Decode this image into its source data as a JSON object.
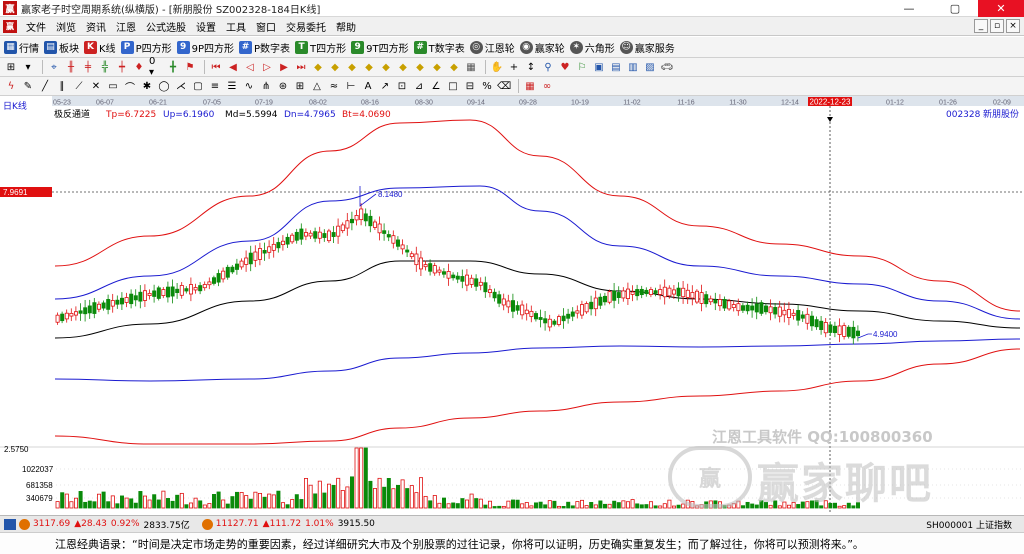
{
  "window": {
    "app_icon": "赢",
    "title": "赢家老子时空周期系统(纵横版) - [新朋股份  SZ002328-184日K线]",
    "buttons": [
      "—",
      "▢",
      "✕"
    ]
  },
  "menu": {
    "icon": "赢",
    "items": [
      "文件",
      "浏览",
      "资讯",
      "江恩",
      "公式选股",
      "设置",
      "工具",
      "窗口",
      "交易委托",
      "帮助"
    ],
    "mdi_buttons": [
      "_",
      "▫",
      "×"
    ]
  },
  "toolbar1": {
    "items": [
      {
        "icon": "grid-icon",
        "label": "行情",
        "color": "#2255aa"
      },
      {
        "icon": "blocks-icon",
        "label": "板块",
        "color": "#2255aa"
      },
      {
        "icon": "kline-icon",
        "label": "K线",
        "color": "#cc2222"
      },
      {
        "icon": "p-icon",
        "label": "P四方形",
        "color": "#3366cc"
      },
      {
        "icon": "9p-icon",
        "label": "9P四方形",
        "color": "#3366cc"
      },
      {
        "icon": "pnum-icon",
        "label": "P数字表",
        "color": "#3366cc"
      },
      {
        "icon": "t-icon",
        "label": "T四方形",
        "color": "#2a8a2a"
      },
      {
        "icon": "9t-icon",
        "label": "9T四方形",
        "color": "#2a8a2a"
      },
      {
        "icon": "tnum-icon",
        "label": "T数字表",
        "color": "#2a8a2a"
      },
      {
        "icon": "gann-wheel-icon",
        "label": "江恩轮",
        "color": "#444444"
      },
      {
        "icon": "winner-wheel-icon",
        "label": "赢家轮",
        "color": "#444444"
      },
      {
        "icon": "hexagon-icon",
        "label": "六角形",
        "color": "#444444"
      },
      {
        "icon": "service-icon",
        "label": "赢家服务",
        "color": "#444444"
      }
    ]
  },
  "chart_info": {
    "period_label": "日K线",
    "indicator_name": "极反通道",
    "tp": "Tp=6.7225",
    "up": "Up=6.1960",
    "md": "Md=5.5994",
    "dn": "Dn=4.7965",
    "bt": "Bt=4.0690",
    "code": "002328",
    "stock_name": "新朋股份",
    "price_marker": "7.9691",
    "high_label": "8.1480",
    "low_label": "4.9400",
    "current_date": "2022-12-23",
    "volume_max": "2.5750",
    "volume_ticks": [
      "1022037",
      "681358",
      "340679"
    ],
    "dates": [
      "05-23",
      "06-07",
      "06-21",
      "07-05",
      "07-19",
      "08-02",
      "08-16",
      "08-30",
      "09-14",
      "09-28",
      "10-19",
      "11-02",
      "11-16",
      "11-30",
      "12-14",
      "2022-12-23",
      "01-12",
      "01-26",
      "02-09"
    ]
  },
  "status": {
    "sh_index": "3117.69",
    "sh_change": "▲28.43",
    "sh_pct": "0.92%",
    "sh_amount": "2833.75亿",
    "sz_index": "11127.71",
    "sz_change": "▲111.72",
    "sz_pct": "1.01%",
    "sz_amount": "3915.50",
    "right_text": "SH000001 上证指数"
  },
  "footer": {
    "quote": "江恩经典语录：“时间是决定市场走势的重要因素，经过详细研究大市及个别股票的过往记录，你将可以证明，历史确实重复发生；而了解过往，你将可以预测将来。”。"
  },
  "watermark": {
    "line1": "江恩工具软件  QQ:100800360",
    "line2": "赢家聊吧",
    "logo": "赢",
    "url": "jiaoba.yy..."
  },
  "colors": {
    "up": "#e01010",
    "down": "#0a8a0a",
    "red_band": "#e01010",
    "blue_band": "#1a1ad0",
    "mid_line": "#000000"
  }
}
